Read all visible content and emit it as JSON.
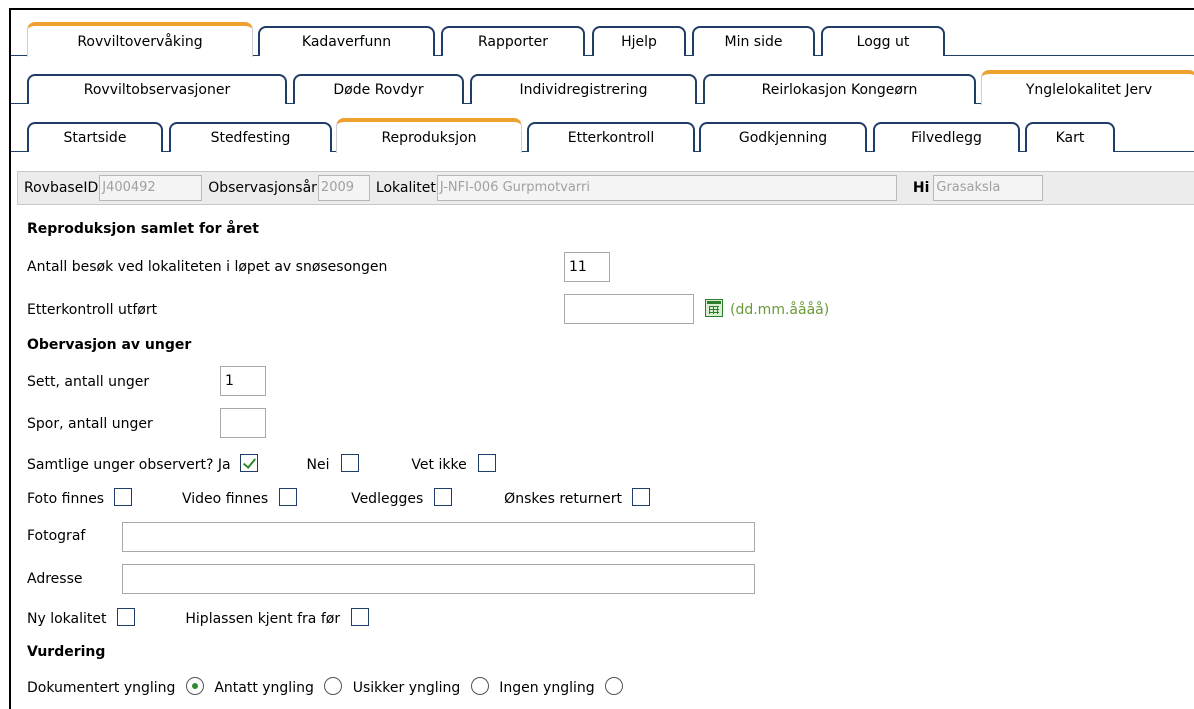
{
  "tabs_row1": [
    {
      "label": "Rovviltovervåking",
      "active": true
    },
    {
      "label": "Kadaverfunn",
      "active": false
    },
    {
      "label": "Rapporter",
      "active": false
    },
    {
      "label": "Hjelp",
      "active": false
    },
    {
      "label": "Min side",
      "active": false
    },
    {
      "label": "Logg ut",
      "active": false
    }
  ],
  "tabs_row2": [
    {
      "label": "Rovviltobservasjoner",
      "active": false
    },
    {
      "label": "Døde Rovdyr",
      "active": false
    },
    {
      "label": "Individregistrering",
      "active": false
    },
    {
      "label": "Reirlokasjon Kongeørn",
      "active": false
    },
    {
      "label": "Ynglelokalitet Jerv",
      "active": true
    }
  ],
  "tabs_row3": [
    {
      "label": "Startside",
      "active": false
    },
    {
      "label": "Stedfesting",
      "active": false
    },
    {
      "label": "Reproduksjon",
      "active": true
    },
    {
      "label": "Etterkontroll",
      "active": false
    },
    {
      "label": "Godkjenning",
      "active": false
    },
    {
      "label": "Filvedlegg",
      "active": false
    },
    {
      "label": "Kart",
      "active": false
    }
  ],
  "info": {
    "rovbase_label": "RovbaseID",
    "rovbase_value": "J400492",
    "year_label": "Observasjonsår",
    "year_value": "2009",
    "lokalitet_label": "Lokalitet",
    "lokalitet_value": "J-NFI-006 Gurpmotvarri",
    "hi_label": "Hi",
    "hi_value": "Grasaksla"
  },
  "form": {
    "section_repro": "Reproduksjon samlet for året",
    "visits_label": "Antall besøk ved lokaliteten i løpet av snøsesongen",
    "visits_value": "11",
    "etterkontroll_label": "Etterkontroll utført",
    "etterkontroll_value": "",
    "date_hint": "(dd.mm.åååå)",
    "section_unger": "Obervasjon av unger",
    "sett_label": "Sett, antall unger",
    "sett_value": "1",
    "spor_label": "Spor, antall unger",
    "spor_value": "",
    "samtlige_label": "Samtlige unger observert? Ja",
    "samtlige_ja_checked": true,
    "nei_label": "Nei",
    "vet_ikke_label": "Vet ikke",
    "foto_label": "Foto finnes",
    "video_label": "Video finnes",
    "vedlegges_label": "Vedlegges",
    "returnert_label": "Ønskes returnert",
    "fotograf_label": "Fotograf",
    "fotograf_value": "",
    "adresse_label": "Adresse",
    "adresse_value": "",
    "ny_lok_label": "Ny lokalitet",
    "kjent_label": "Hiplassen kjent fra før",
    "section_vurdering": "Vurdering",
    "vurdering_options": [
      {
        "label": "Dokumentert yngling",
        "checked": true
      },
      {
        "label": "Antatt yngling",
        "checked": false
      },
      {
        "label": "Usikker yngling",
        "checked": false
      },
      {
        "label": "Ingen yngling",
        "checked": false
      }
    ]
  },
  "colors": {
    "tab_border": "#1f3d66",
    "active_accent": "#f0a030",
    "check_green": "#2e8b2e",
    "hint_green": "#6a9a3a"
  }
}
